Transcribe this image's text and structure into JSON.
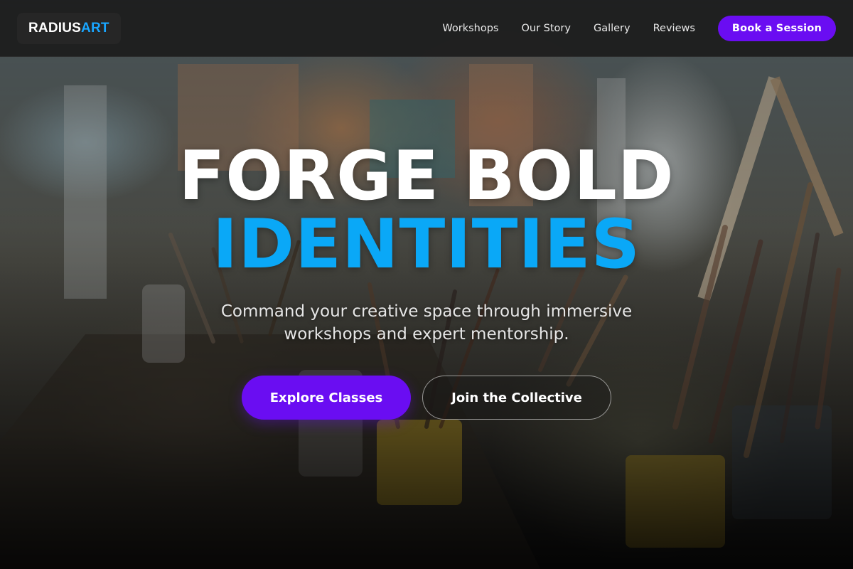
{
  "brand": {
    "logo_part1": "RADIUS",
    "logo_part2": "ART"
  },
  "nav": {
    "links": [
      {
        "label": "Workshops"
      },
      {
        "label": "Our Story"
      },
      {
        "label": "Gallery"
      },
      {
        "label": "Reviews"
      }
    ],
    "cta_label": "Book a Session"
  },
  "hero": {
    "headline_line1": "FORGE BOLD",
    "headline_line2": "IDENTITIES",
    "subtitle": "Command your creative space through immersive workshops and expert mentorship.",
    "primary_button": "Explore Classes",
    "secondary_button": "Join the Collective"
  },
  "colors": {
    "accent_purple": "#6a0df2",
    "accent_blue": "#0aa8f7",
    "navbar_bg": "#1c1c1c"
  }
}
